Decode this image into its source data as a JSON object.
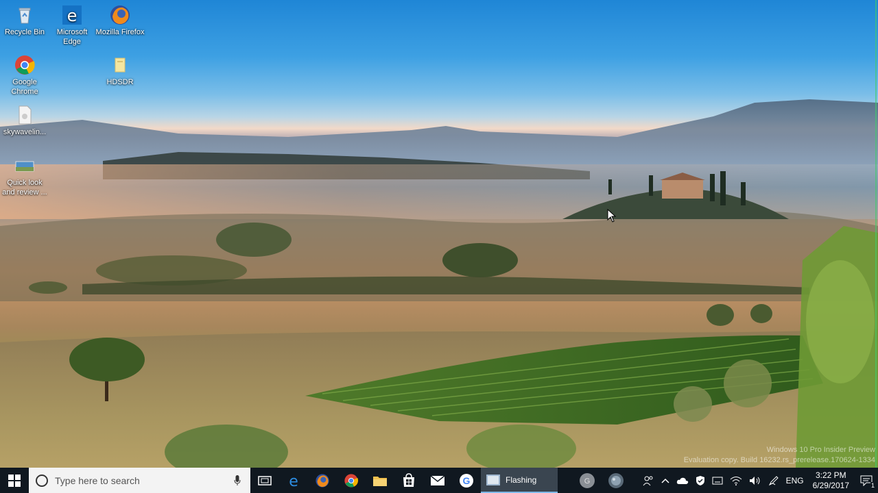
{
  "desktop": {
    "icons": [
      {
        "label": "Recycle Bin",
        "icon": "recycle-bin-icon"
      },
      {
        "label": "Microsoft Edge",
        "icon": "edge-icon"
      },
      {
        "label": "Mozilla Firefox",
        "icon": "firefox-icon"
      },
      {
        "label": "Google Chrome",
        "icon": "chrome-icon"
      },
      {
        "label": "HDSDR",
        "icon": "folder-icon"
      },
      {
        "label": "skywavelin...",
        "icon": "file-icon"
      },
      {
        "label": "Quick look and review ...",
        "icon": "image-file-icon"
      }
    ]
  },
  "watermark": {
    "line1": "Windows 10 Pro Insider Preview",
    "line2": "Evaluation copy. Build 16232.rs_prerelease.170624-1334"
  },
  "taskbar": {
    "search_placeholder": "Type here to search",
    "pinned": [
      "task-view-icon",
      "edge-icon",
      "firefox-icon",
      "chrome-icon",
      "file-explorer-icon",
      "store-icon",
      "mail-icon",
      "google-icon"
    ],
    "active_app": "Flashing",
    "tray": {
      "language": "ENG",
      "time": "3:22 PM",
      "date": "6/29/2017",
      "notification_count": "1"
    }
  },
  "colors": {
    "taskbar_bg": "#101820",
    "accent": "#7fb8e8"
  }
}
